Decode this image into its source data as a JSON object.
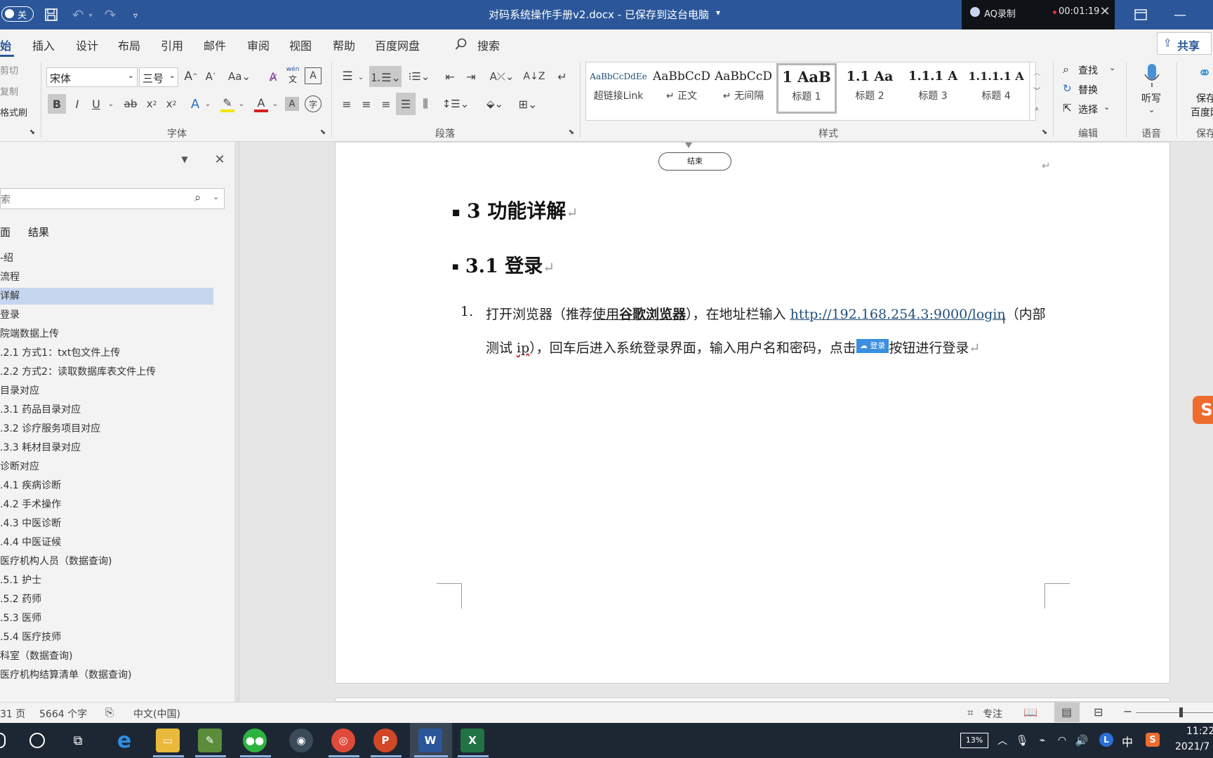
{
  "window": {
    "autosave_label": "关",
    "title": "对码系统操作手册v2.docx - 已保存到这台电脑",
    "title_dropdown": "▾"
  },
  "recorder": {
    "app_name": "AQ录制",
    "time": "00:01:19"
  },
  "ribbon_tabs": [
    "开始",
    "插入",
    "设计",
    "布局",
    "引用",
    "邮件",
    "审阅",
    "视图",
    "帮助",
    "百度网盘"
  ],
  "ribbon_tab_visible": [
    "始",
    "插入",
    "设计",
    "布局",
    "引用",
    "邮件",
    "审阅",
    "视图",
    "帮助",
    "百度网盘"
  ],
  "search_label": "搜索",
  "share_label": "共享",
  "clipboard": {
    "cut": "剪切",
    "copy": "复制",
    "format_painter": "格式刷",
    "cut_visible": "剪切",
    "copy_visible": "复制",
    "fp_visible": "格式刷"
  },
  "font": {
    "family": "宋体",
    "size": "三号",
    "group_label": "字体"
  },
  "paragraph_group": "段落",
  "styles": {
    "group_label": "样式",
    "items": [
      {
        "preview": "AaBbCcDdEe",
        "name": "超链接Link"
      },
      {
        "preview": "AaBbCcD",
        "name": "↵ 正文"
      },
      {
        "preview": "AaBbCcD",
        "name": "↵ 无间隔"
      },
      {
        "preview": "1  AaB",
        "name": "标题 1"
      },
      {
        "preview": "1.1  Aa",
        "name": "标题 2"
      },
      {
        "preview": "1.1.1  A",
        "name": "标题 3"
      },
      {
        "preview": "1.1.1.1  A",
        "name": "标题 4"
      }
    ]
  },
  "editing": {
    "find": "查找",
    "replace": "替换",
    "select": "选择",
    "group_label": "编辑"
  },
  "voice": {
    "dictate": "听写",
    "group_label": "语音"
  },
  "save_group": {
    "label1": "保存",
    "label2": "百度网",
    "group_label": "保存"
  },
  "nav": {
    "search_placeholder": "索",
    "tabs": [
      "面",
      "结果"
    ],
    "items": [
      "介绍",
      "流程",
      "详解",
      "登录",
      "院端数据上传",
      "2.1 方式1：txt包文件上传",
      "2.2 方式2：读取数据库表文件上传",
      "目录对应",
      "3.1 药品目录对应",
      "3.2 诊疗服务项目对应",
      "3.3 耗材目录对应",
      "诊断对应",
      "4.1 疾病诊断",
      "4.2 手术操作",
      "4.3 中医诊断",
      "4.4 中医证候",
      "医疗机构人员（数据查询)",
      "5.1 护士",
      "5.2 药师",
      "5.3 医师",
      "5.4 医疗技师",
      "科室（数据查询)",
      "医疗机构结算清单（数据查询)"
    ],
    "visible": [
      "-绍",
      "流程",
      "详解",
      "登录",
      "院端数据上传",
      ".2.1 方式1：txt包文件上传",
      ".2.2 方式2：读取数据库表文件上传",
      "目录对应",
      ".3.1 药品目录对应",
      ".3.2 诊疗服务项目对应",
      ".3.3 耗材目录对应",
      "诊断对应",
      ".4.1 疾病诊断",
      ".4.2 手术操作",
      ".4.3 中医诊断",
      ".4.4 中医证候",
      "医疗机构人员（数据查询)",
      ".5.1 护士",
      ".5.2 药师",
      ".5.3 医师",
      ".5.4 医疗技师",
      "科室（数据查询)",
      "医疗机构结算清单（数据查询)"
    ],
    "selected_index": 2
  },
  "document": {
    "flow_end_label": "结束",
    "heading1": "3 功能详解",
    "heading2": "3.1 登录",
    "list_number": "1.",
    "line1_a": "打开浏览器（推荐",
    "line1_b": "使用",
    "line1_c": "谷歌浏览器",
    "line1_d": "），在地址栏输入 ",
    "url": "http://192.168.254.3:9000/login",
    "line1_e": "（内部",
    "line2_a": "测试 ",
    "line2_b": "ip",
    "line2_c": "），回车后进入系统登录界面，输入用户名和密码，点击",
    "login_button": "登录",
    "line2_d": "按钮进行登录",
    "para_mark": "↵"
  },
  "status": {
    "pages": "31 页",
    "words": "5664 个字",
    "language": "中文(中国)",
    "focus": "专注"
  },
  "taskbar": {
    "battery": "13%",
    "ime": "中",
    "time": "11:22",
    "date": "2021/7"
  },
  "colors": {
    "title_bar": "#2b579a",
    "nav_selected": "#c5d6ef",
    "link": "#1f4e79",
    "login_btn": "#3b8fe0"
  }
}
